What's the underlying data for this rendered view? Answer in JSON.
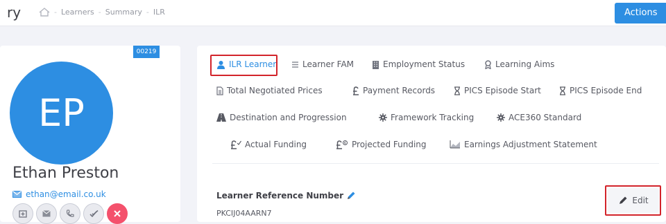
{
  "header": {
    "title_fragment": "ry",
    "breadcrumbs": [
      "Learners",
      "Summary",
      "ILR"
    ],
    "breadcrumb_separator": "-",
    "actions_label": "Actions"
  },
  "profile": {
    "id_badge": "00219",
    "initials": "EP",
    "name": "Ethan Preston",
    "email": "ethan@email.co.uk",
    "quick_actions": [
      "add-icon",
      "mail-icon",
      "phone-icon",
      "check-all-icon",
      "close-icon"
    ]
  },
  "tabs": {
    "row1": [
      "ILR Learner",
      "Learner FAM",
      "Employment Status",
      "Learning Aims"
    ],
    "row2": [
      "Total Negotiated Prices",
      "Payment Records",
      "PICS Episode Start",
      "PICS Episode End"
    ],
    "row3": [
      "Destination and Progression",
      "Framework Tracking",
      "ACE360 Standard"
    ],
    "row4": [
      "Actual Funding",
      "Projected Funding",
      "Earnings Adjustment Statement"
    ],
    "active": "ILR Learner"
  },
  "field": {
    "label": "Learner Reference Number",
    "value": "PKCIJ04AARN7"
  },
  "edit_label": "Edit",
  "colors": {
    "accent": "#2d8ee2",
    "highlight": "#d2232a",
    "danger": "#f4516c"
  }
}
